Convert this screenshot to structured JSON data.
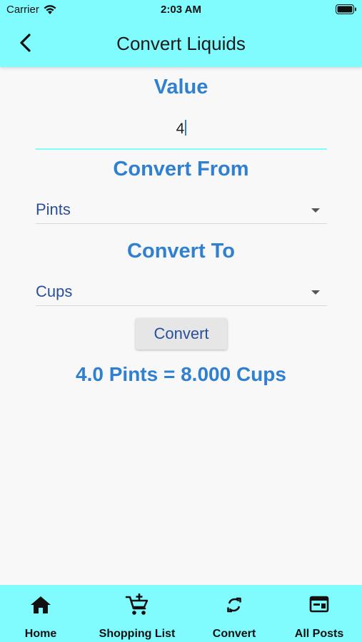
{
  "status_bar": {
    "carrier": "Carrier",
    "time": "2:03 AM"
  },
  "header": {
    "title": "Convert Liquids",
    "back_icon": "chevron-left-icon"
  },
  "form": {
    "value_label": "Value",
    "value": "4",
    "from_label": "Convert From",
    "from_selected": "Pints",
    "to_label": "Convert To",
    "to_selected": "Cups",
    "convert_button": "Convert",
    "result": "4.0 Pints = 8.000 Cups"
  },
  "colors": {
    "accent": "#80fbfe",
    "label_blue": "#2f80d0",
    "dropdown_text": "#2a4f9a"
  },
  "tabbar": {
    "items": [
      {
        "label": "Home",
        "icon": "home-icon"
      },
      {
        "label": "Shopping List",
        "icon": "cart-add-icon"
      },
      {
        "label": "Convert",
        "icon": "refresh-icon"
      },
      {
        "label": "All Posts",
        "icon": "posts-icon"
      }
    ]
  }
}
